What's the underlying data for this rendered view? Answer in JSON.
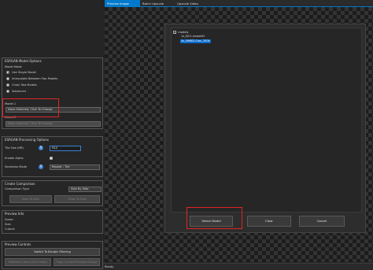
{
  "tabs": [
    "Preview Image",
    "Batch Upscale",
    "Upscale Video"
  ],
  "model_options": {
    "title": "ESRGAN Model Options",
    "mode_label": "Model Mode",
    "modes": [
      {
        "label": "Use Single Model",
        "selected": true
      },
      {
        "label": "Interpolate Between Two Models",
        "selected": false
      },
      {
        "label": "Chain Two Models",
        "selected": false
      },
      {
        "label": "Advanced",
        "selected": false
      }
    ],
    "model1_label": "Model 1",
    "model1_value": "None Selected, Click To Change",
    "model2_label": "Model 2",
    "model2_value": "None Selected, Click To Change"
  },
  "processing": {
    "title": "ESRGAN Processing Options",
    "tile_size_label": "Tile Size (HR)",
    "tile_size_value": "512",
    "enable_alpha_label": "Enable Alpha",
    "enable_alpha_checked": true,
    "seamless_label": "Seamless Mode",
    "seamless_value": "Repeat : Tile",
    "help_glyph": "?"
  },
  "comparison": {
    "title": "Create Comparison",
    "type_label": "Comparison Type",
    "type_value": "Side By Side",
    "save_label": "Save To Disk",
    "show_label": "Show To Disk"
  },
  "preview_info": {
    "title": "Preview Info",
    "zoom": "Zoom:",
    "size": "Size:",
    "cutout": "Cutout:"
  },
  "preview_controls": {
    "title": "Preview Controls",
    "switch_label": "Switch To Bicubic Filtering",
    "refresh_label": "Refresh Cutout (full image)",
    "copy_label": "Copy Current Preview Output"
  },
  "model_dialog": {
    "tree_root": "models",
    "items": [
      "1x_BC1-smooth2",
      "4x_NMKD-Siax_200k"
    ],
    "select_label": "Select Model",
    "clear_label": "Clear",
    "cancel_label": "Cancel"
  },
  "status": "Ready.",
  "colors": {
    "accent": "#007acc",
    "highlight": "#e02424",
    "selection": "#0a68c8"
  }
}
